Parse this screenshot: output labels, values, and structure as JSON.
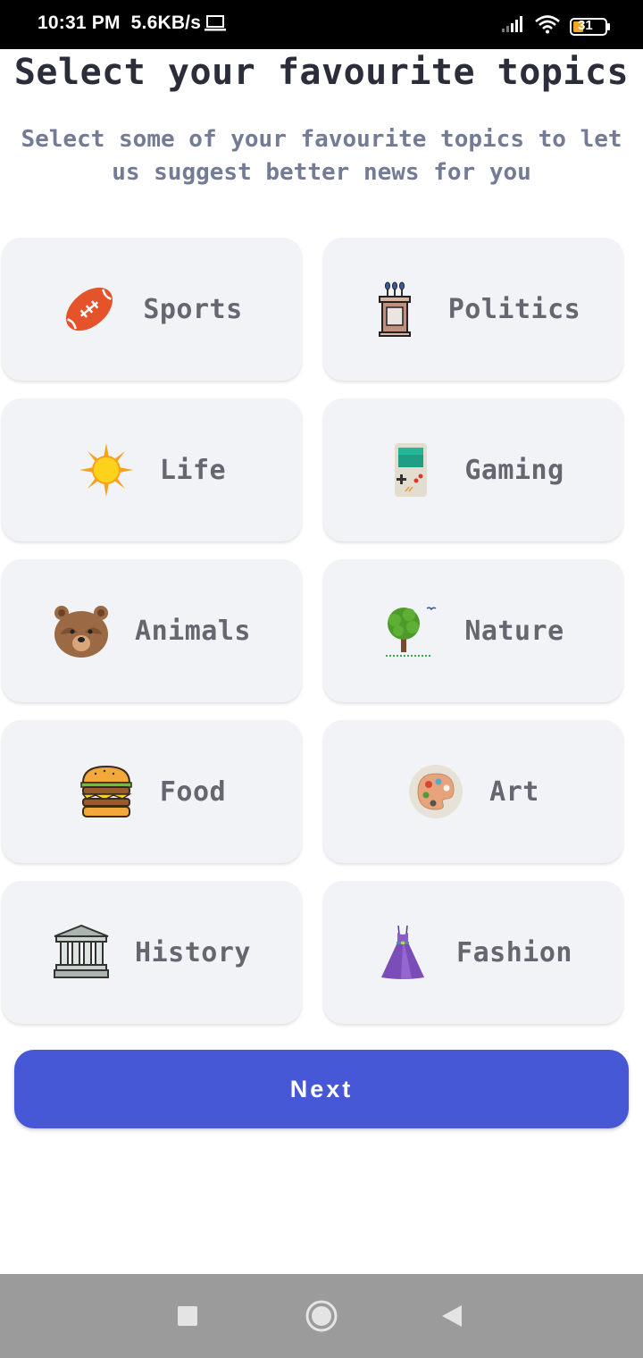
{
  "status_bar": {
    "time": "10:31 PM",
    "speed": "5.6KB/s",
    "battery": "31",
    "icons": [
      "laptop-icon",
      "signal-icon",
      "wifi-icon",
      "battery-icon"
    ]
  },
  "header": {
    "title": "Select your favourite topics",
    "subtitle": "Select some of your favourite topics to let us suggest better news for you"
  },
  "topics": [
    {
      "label": "Sports",
      "icon": "football-icon"
    },
    {
      "label": "Politics",
      "icon": "podium-icon"
    },
    {
      "label": "Life",
      "icon": "sun-icon"
    },
    {
      "label": "Gaming",
      "icon": "gameboy-icon"
    },
    {
      "label": "Animals",
      "icon": "bear-icon"
    },
    {
      "label": "Nature",
      "icon": "tree-icon"
    },
    {
      "label": "Food",
      "icon": "burger-icon"
    },
    {
      "label": "Art",
      "icon": "palette-icon"
    },
    {
      "label": "History",
      "icon": "museum-icon"
    },
    {
      "label": "Fashion",
      "icon": "dress-icon"
    }
  ],
  "next_button": {
    "label": "Next"
  },
  "nav_bar": {
    "buttons": [
      "recents-button",
      "home-button",
      "back-button"
    ]
  },
  "colors": {
    "accent": "#4758d6",
    "card_bg": "#f2f3f6",
    "title": "#2b2d3b",
    "subtitle": "#737b96",
    "label": "#656770",
    "nav_bg": "#9b9b9b"
  }
}
